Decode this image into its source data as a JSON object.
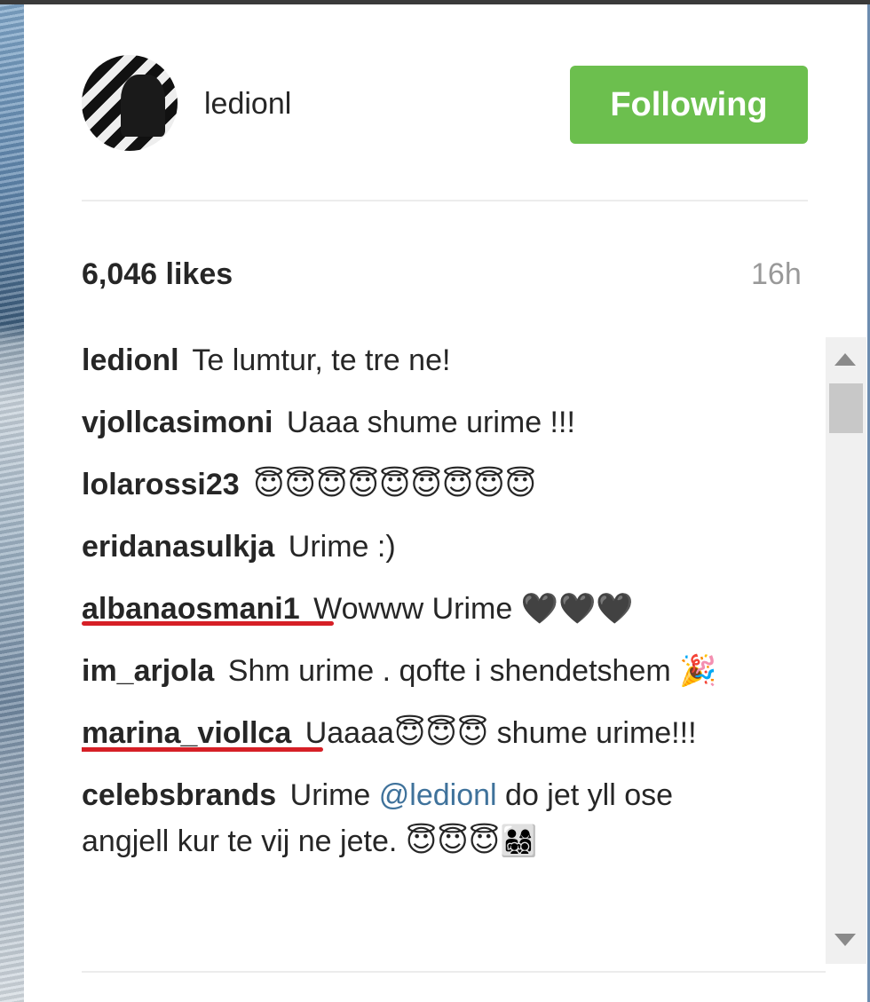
{
  "post": {
    "username": "ledionl",
    "follow_label": "Following",
    "likes": "6,046 likes",
    "time": "16h"
  },
  "comments": [
    {
      "user": "ledionl",
      "text": "Te lumtur, te tre ne!"
    },
    {
      "user": "vjollcasimoni",
      "text": "Uaaa shume urime !!!"
    },
    {
      "user": "lolarossi23",
      "text": "😇😇😇😇😇😇😇😇😇"
    },
    {
      "user": "eridanasulkja",
      "text": "Urime :)"
    },
    {
      "user": "albanaosmani1",
      "text": "Wowww Urime 🖤🖤🖤"
    },
    {
      "user": "im_arjola",
      "text": "Shm urime . qofte i shendetshem 🎉"
    },
    {
      "user": "marina_viollca",
      "text": "Uaaaa😇😇😇 shume urime!!!"
    },
    {
      "user": "celebsbrands",
      "text_before": "Urime ",
      "mention": "@ledionl",
      "text_after": " do jet yll ose angjell kur te vij ne jete. 😇😇😇👨‍👩‍👧‍👦"
    }
  ],
  "colors": {
    "follow_green": "#6cbf4e",
    "mention_blue": "#3f729b",
    "highlight_red": "#d61f26"
  }
}
